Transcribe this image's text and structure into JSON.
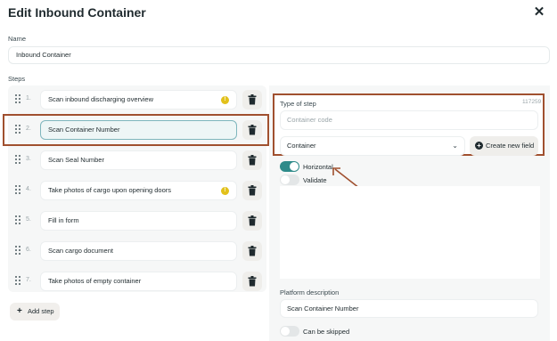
{
  "modal": {
    "title": "Edit Inbound Container",
    "close_icon": "close-icon"
  },
  "name": {
    "label": "Name",
    "value": "Inbound Container"
  },
  "steps": {
    "label": "Steps",
    "items": [
      {
        "num": "1.",
        "label": "Scan inbound discharging overview",
        "warning": true
      },
      {
        "num": "2.",
        "label": "Scan Container Number",
        "warning": false,
        "active": true
      },
      {
        "num": "3.",
        "label": "Scan Seal Number",
        "warning": false
      },
      {
        "num": "4.",
        "label": "Take photos of cargo upon opening doors",
        "warning": true
      },
      {
        "num": "5.",
        "label": "Fill in form",
        "warning": false
      },
      {
        "num": "6.",
        "label": "Scan cargo document",
        "warning": false
      },
      {
        "num": "7.",
        "label": "Take photos of empty container",
        "warning": false
      }
    ],
    "add_label": "Add step"
  },
  "step_detail": {
    "type_label": "Type of step",
    "type_id": "117259",
    "code_placeholder": "Container code",
    "type_select": "Container",
    "create_field_label": "Create new field",
    "toggles": [
      {
        "label": "Horizontal",
        "on": true
      },
      {
        "label": "Validate",
        "on": false
      }
    ],
    "platform_description_label": "Platform description",
    "platform_description_value": "Scan Container Number",
    "skip_label": "Can be skipped",
    "skip_on": false
  },
  "colors": {
    "accent": "#2e8b8a",
    "highlight": "#a0502f",
    "warning": "#e2c11b"
  }
}
